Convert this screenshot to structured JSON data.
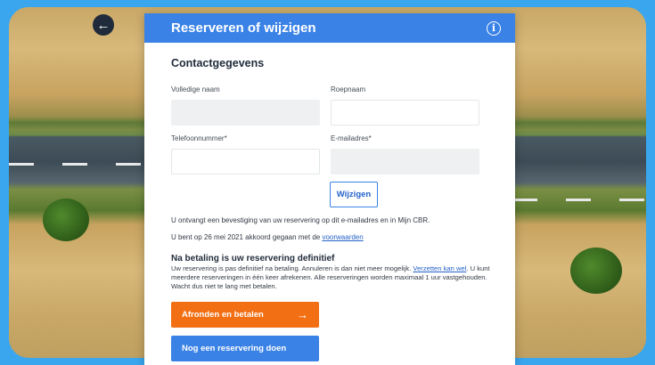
{
  "header": {
    "title": "Reserveren of wijzigen",
    "info_icon": "i",
    "back_icon": "←"
  },
  "contact": {
    "section_title": "Contactgegevens",
    "full_name": {
      "label": "Volledige naam",
      "value": ""
    },
    "first_name": {
      "label": "Roepnaam",
      "value": ""
    },
    "phone": {
      "label": "Telefoonnummer*",
      "value": ""
    },
    "email": {
      "label": "E-mailadres*",
      "value": ""
    },
    "edit_button": "Wijzigen"
  },
  "confirmation_text": "U ontvangt een bevestiging van uw reservering op dit e-mailadres en in Mijn CBR.",
  "terms": {
    "prefix": "U bent op 26 mei 2021 akkoord gegaan met de ",
    "link": "voorwaarden"
  },
  "definitive": {
    "heading": "Na betaling is uw reservering definitief",
    "text_1": "Uw reservering is pas definitief na betaling. Annuleren is dan niet meer mogelijk. ",
    "link": "Verzetten kan wel",
    "text_2": ". U kunt meerdere reserveringen in één keer afrekenen. Alle reserveringen worden maximaal 1 uur vastgehouden. Wacht dus niet te lang met betalen."
  },
  "actions": {
    "pay_button": "Afronden en betalen",
    "pay_arrow": "→",
    "another_button": "Nog een reservering doen"
  },
  "colors": {
    "primary_blue": "#3b82e6",
    "accent_orange": "#f36f13",
    "frame_blue": "#3aa6ee"
  }
}
